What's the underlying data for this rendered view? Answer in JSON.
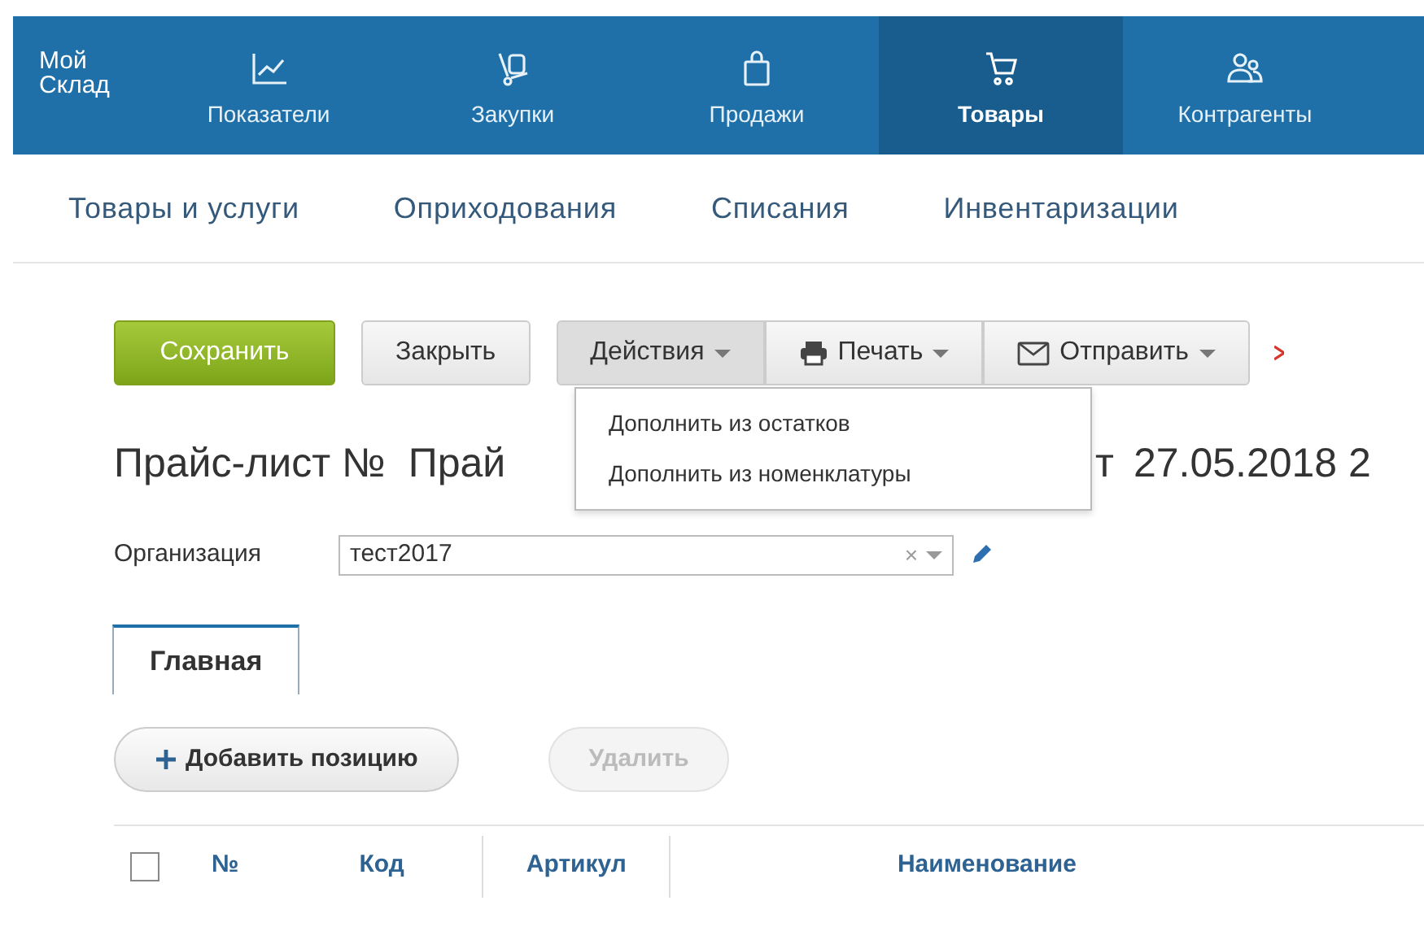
{
  "logo": {
    "line_1": "Мой",
    "line_2": "Склад"
  },
  "nav": [
    {
      "label": "Показатели",
      "selected": false
    },
    {
      "label": "Закупки",
      "selected": false
    },
    {
      "label": "Продажи",
      "selected": false
    },
    {
      "label": "Товары",
      "selected": true
    },
    {
      "label": "Контрагенты",
      "selected": false
    }
  ],
  "subnav": [
    "Товары и услуги",
    "Оприходования",
    "Списания",
    "Инвентаризации"
  ],
  "toolbar": [
    {
      "label": "Сохранить",
      "kind": "primary"
    },
    {
      "label": "Закрыть",
      "kind": "plain"
    },
    {
      "label": "Действия",
      "kind": "menu",
      "expanded": true
    },
    {
      "label": "Печать",
      "kind": "print",
      "expanded": false
    },
    {
      "label": "Отправить",
      "kind": "mail",
      "expanded": false
    }
  ],
  "actions_menu": [
    "Дополнить из остатков",
    "Дополнить из номенклатуры"
  ],
  "title": {
    "prefix": "Прайс-лист №",
    "number": "Прай",
    "date_prefix": "т",
    "date": "27.05.2018 2"
  },
  "organization": {
    "label": "Организация",
    "value": "тест2017",
    "clear": "×"
  },
  "tabs": [
    {
      "label": "Главная",
      "selected": true
    }
  ],
  "positions": [
    {
      "label": "Добавить позицию",
      "kind": "add",
      "disabled": false
    },
    {
      "label": "Удалить",
      "kind": "plain",
      "disabled": true
    }
  ],
  "table": {
    "columns": [
      "№",
      "Код",
      "Артикул",
      "Наименование"
    ],
    "select_all_checked": false
  }
}
